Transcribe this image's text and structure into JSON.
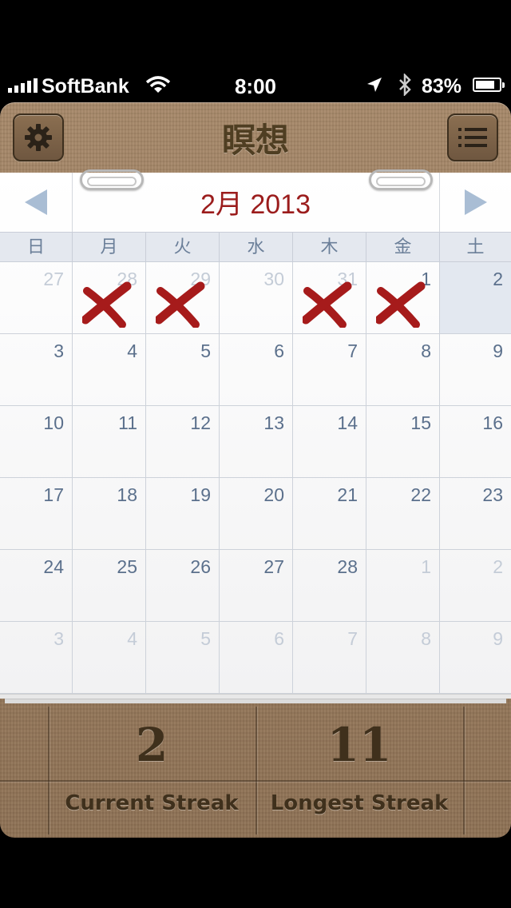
{
  "status_bar": {
    "carrier": "SoftBank",
    "time": "8:00",
    "battery": "83%",
    "battery_level": 0.83
  },
  "header": {
    "title": "瞑想",
    "settings_icon": "gear-icon",
    "menu_icon": "list-icon"
  },
  "calendar": {
    "month_label": "2月 2013",
    "weekdays": [
      "日",
      "月",
      "火",
      "水",
      "木",
      "金",
      "土"
    ],
    "weeks": [
      [
        {
          "d": "27",
          "dim": true
        },
        {
          "d": "28",
          "dim": true,
          "x": true
        },
        {
          "d": "29",
          "dim": true,
          "x": true
        },
        {
          "d": "30",
          "dim": true
        },
        {
          "d": "31",
          "dim": true,
          "x": true
        },
        {
          "d": "1",
          "x": true
        },
        {
          "d": "2",
          "today": true
        }
      ],
      [
        {
          "d": "3"
        },
        {
          "d": "4"
        },
        {
          "d": "5"
        },
        {
          "d": "6"
        },
        {
          "d": "7"
        },
        {
          "d": "8"
        },
        {
          "d": "9"
        }
      ],
      [
        {
          "d": "10"
        },
        {
          "d": "11"
        },
        {
          "d": "12"
        },
        {
          "d": "13"
        },
        {
          "d": "14"
        },
        {
          "d": "15"
        },
        {
          "d": "16"
        }
      ],
      [
        {
          "d": "17"
        },
        {
          "d": "18"
        },
        {
          "d": "19"
        },
        {
          "d": "20"
        },
        {
          "d": "21"
        },
        {
          "d": "22"
        },
        {
          "d": "23"
        }
      ],
      [
        {
          "d": "24"
        },
        {
          "d": "25"
        },
        {
          "d": "26"
        },
        {
          "d": "27"
        },
        {
          "d": "28"
        },
        {
          "d": "1",
          "dim": true
        },
        {
          "d": "2",
          "dim": true
        }
      ],
      [
        {
          "d": "3",
          "dim": true
        },
        {
          "d": "4",
          "dim": true
        },
        {
          "d": "5",
          "dim": true
        },
        {
          "d": "6",
          "dim": true
        },
        {
          "d": "7",
          "dim": true
        },
        {
          "d": "8",
          "dim": true
        },
        {
          "d": "9",
          "dim": true
        }
      ]
    ],
    "x_color": "#a61b1b"
  },
  "streaks": {
    "current_value": "2",
    "current_label": "Current Streak",
    "longest_value": "11",
    "longest_label": "Longest Streak"
  }
}
